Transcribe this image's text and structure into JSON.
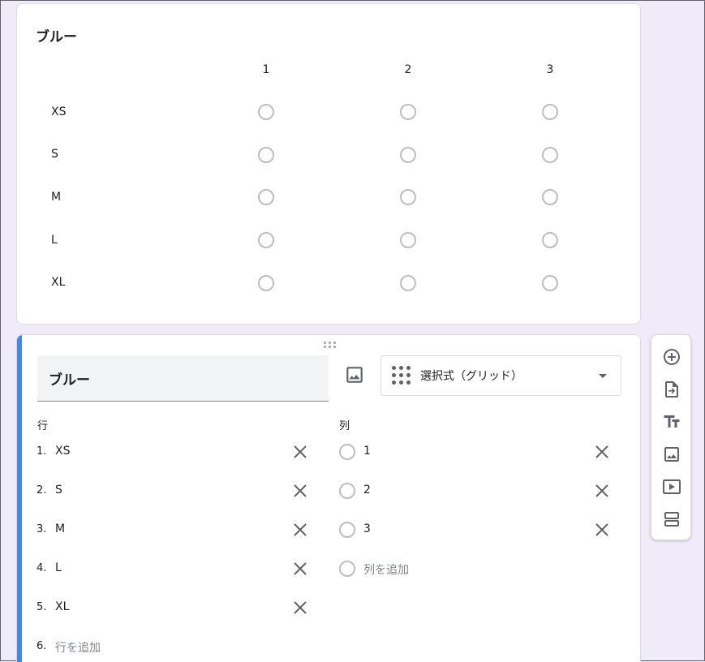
{
  "preview": {
    "title": "ブルー",
    "columns": [
      "1",
      "2",
      "3"
    ],
    "rows": [
      "XS",
      "S",
      "M",
      "L",
      "XL"
    ]
  },
  "editor": {
    "question_title": "ブルー",
    "type_label": "選択式（グリッド）",
    "rows_heading": "行",
    "columns_heading": "列",
    "rows": [
      {
        "num": "1.",
        "label": "XS"
      },
      {
        "num": "2.",
        "label": "S"
      },
      {
        "num": "3.",
        "label": "M"
      },
      {
        "num": "4.",
        "label": "L"
      },
      {
        "num": "5.",
        "label": "XL"
      }
    ],
    "add_row": {
      "num": "6.",
      "label": "行を追加"
    },
    "columns": [
      {
        "label": "1"
      },
      {
        "label": "2"
      },
      {
        "label": "3"
      }
    ],
    "add_column": "列を追加"
  },
  "toolbar": {
    "items": [
      "add-question-icon",
      "import-questions-icon",
      "add-title-icon",
      "add-image-icon",
      "add-video-icon",
      "add-section-icon"
    ]
  },
  "colors": {
    "accent": "#4285f4",
    "background": "#f0ebf8"
  }
}
